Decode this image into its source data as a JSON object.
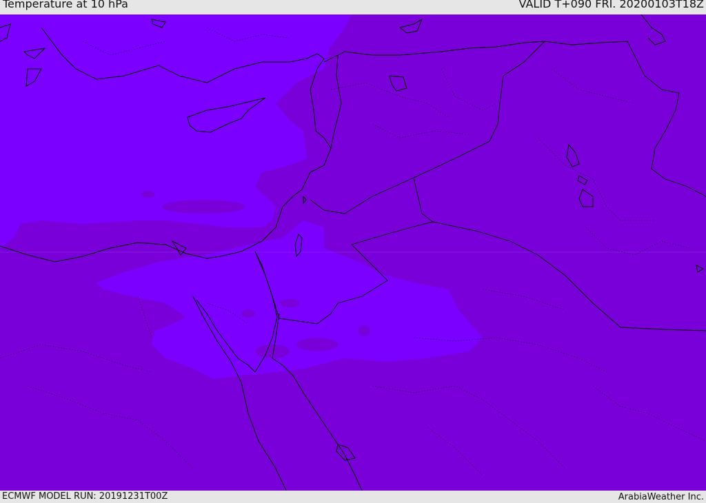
{
  "header": {
    "title": "Temperature at 10 hPa",
    "valid": "VALID T+090 FRI. 20200103T18Z"
  },
  "footer": {
    "model_run": "ECMWF MODEL RUN: 20191231T00Z",
    "brand": "ArabiaWeather Inc."
  },
  "map": {
    "colors": {
      "warm_field": "#7a00da",
      "cool_field": "#7b00ff",
      "coastline": "#000000"
    }
  }
}
